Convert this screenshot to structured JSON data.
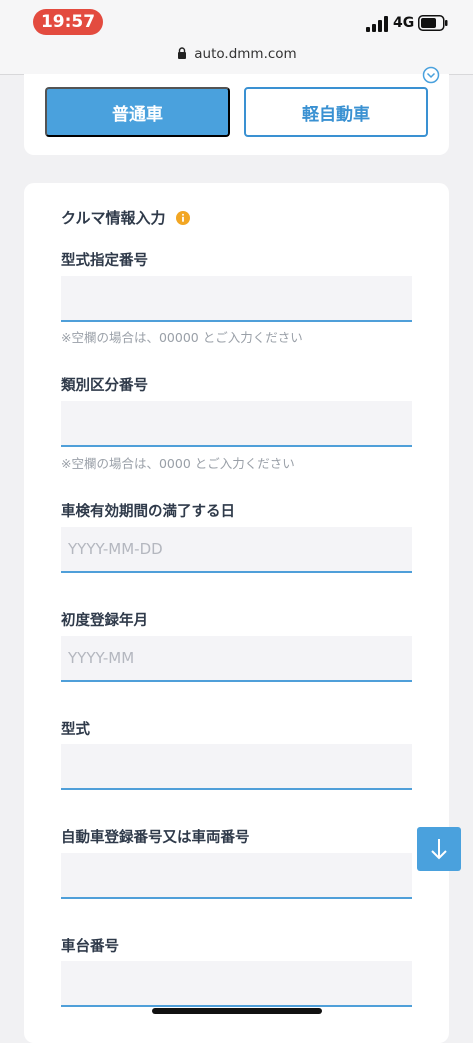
{
  "status_bar": {
    "time": "19:57",
    "network": "4G"
  },
  "browser": {
    "url": "auto.dmm.com"
  },
  "vehicle_type": {
    "options": [
      {
        "label": "普通車",
        "selected": true
      },
      {
        "label": "軽自動車",
        "selected": false
      }
    ]
  },
  "form": {
    "section_title": "クルマ情報入力",
    "fields": [
      {
        "label": "型式指定番号",
        "value": "",
        "placeholder": "",
        "hint": "※空欄の場合は、00000 とご入力ください"
      },
      {
        "label": "類別区分番号",
        "value": "",
        "placeholder": "",
        "hint": "※空欄の場合は、0000 とご入力ください"
      },
      {
        "label": "車検有効期間の満了する日",
        "value": "",
        "placeholder": "YYYY-MM-DD"
      },
      {
        "label": "初度登録年月",
        "value": "",
        "placeholder": "YYYY-MM"
      },
      {
        "label": "型式",
        "value": "",
        "placeholder": ""
      },
      {
        "label": "自動車登録番号又は車両番号",
        "value": "",
        "placeholder": ""
      },
      {
        "label": "車台番号",
        "value": "",
        "placeholder": ""
      }
    ]
  },
  "icons": {
    "lock": "lock-icon",
    "info": "info-icon",
    "scroll_up": "chevron-up-circle-icon",
    "scroll_down": "arrow-down-icon"
  },
  "colors": {
    "accent": "#4aa1dd",
    "outline": "#3a91d2",
    "info": "#f2a623",
    "time_pill": "#e34b3f"
  }
}
